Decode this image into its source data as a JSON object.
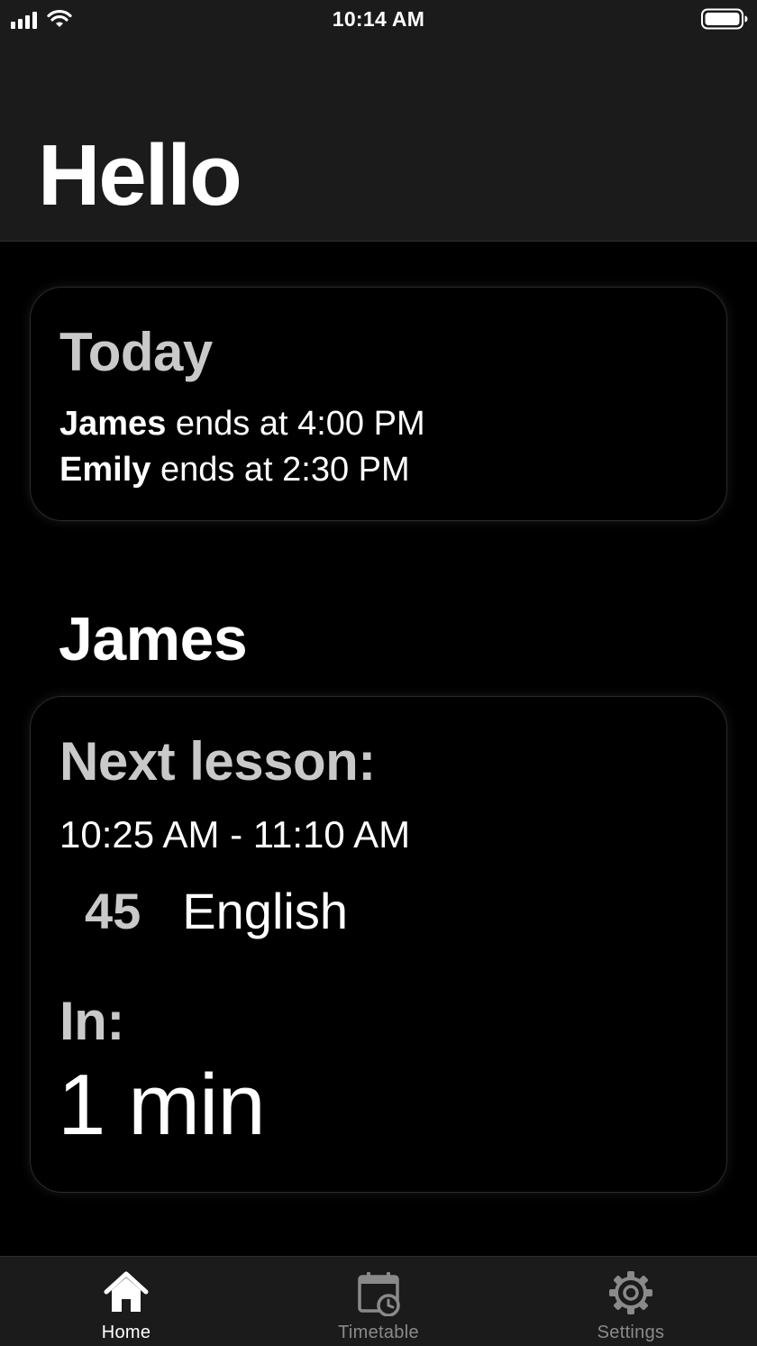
{
  "status_bar": {
    "time": "10:14 AM",
    "signal_icon": "cellular-signal-icon",
    "wifi_icon": "wifi-icon",
    "battery_icon": "battery-full-icon"
  },
  "header": {
    "title": "Hello"
  },
  "today_card": {
    "heading": "Today",
    "entries": [
      {
        "name": "James",
        "text": " ends at 4:00 PM"
      },
      {
        "name": "Emily",
        "text": " ends at 2:30 PM"
      }
    ]
  },
  "student_section": {
    "name": "James",
    "next_lesson_label": "Next lesson:",
    "time_range": "10:25 AM - 11:10 AM",
    "room": "45",
    "subject": "English",
    "in_label": "In:",
    "countdown": "1 min"
  },
  "tab_bar": {
    "tabs": [
      {
        "label": "Home",
        "icon": "home-icon",
        "active": true
      },
      {
        "label": "Timetable",
        "icon": "calendar-clock-icon",
        "active": false
      },
      {
        "label": "Settings",
        "icon": "gear-icon",
        "active": false
      }
    ]
  },
  "colors": {
    "background": "#000000",
    "bar_background": "#1b1b1b",
    "heading_gray": "#c9c9c9",
    "inactive_tab": "#8a8a8a",
    "text": "#ffffff"
  }
}
